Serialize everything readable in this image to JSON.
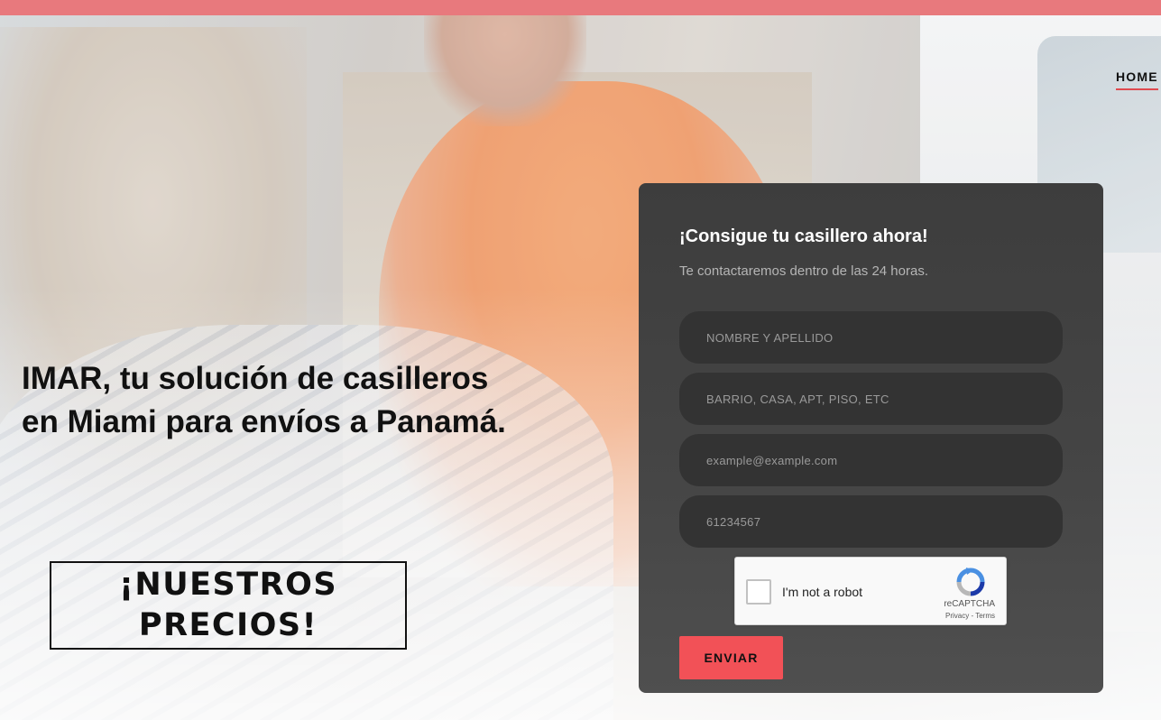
{
  "nav": {
    "home_label": "HOME"
  },
  "hero": {
    "headline": "IMAR, tu solución de casilleros en Miami para envíos a Panamá.",
    "prices_button": "¡NUESTROS PRECIOS!"
  },
  "form": {
    "title": "¡Consigue tu casillero ahora!",
    "subtitle": "Te contactaremos dentro de las 24 horas.",
    "fields": {
      "name_placeholder": "NOMBRE Y APELLIDO",
      "address_placeholder": "BARRIO, CASA, APT, PISO, ETC",
      "email_placeholder": "example@example.com",
      "phone_placeholder": "61234567"
    },
    "captcha": {
      "label": "I'm not a robot",
      "brand": "reCAPTCHA",
      "links": "Privacy - Terms"
    },
    "submit_label": "ENVIAR"
  },
  "colors": {
    "accent": "#f25157",
    "panel": "#444444",
    "field": "#333333",
    "top_strip": "#e8797d"
  },
  "icons": [
    "recaptcha-icon"
  ]
}
